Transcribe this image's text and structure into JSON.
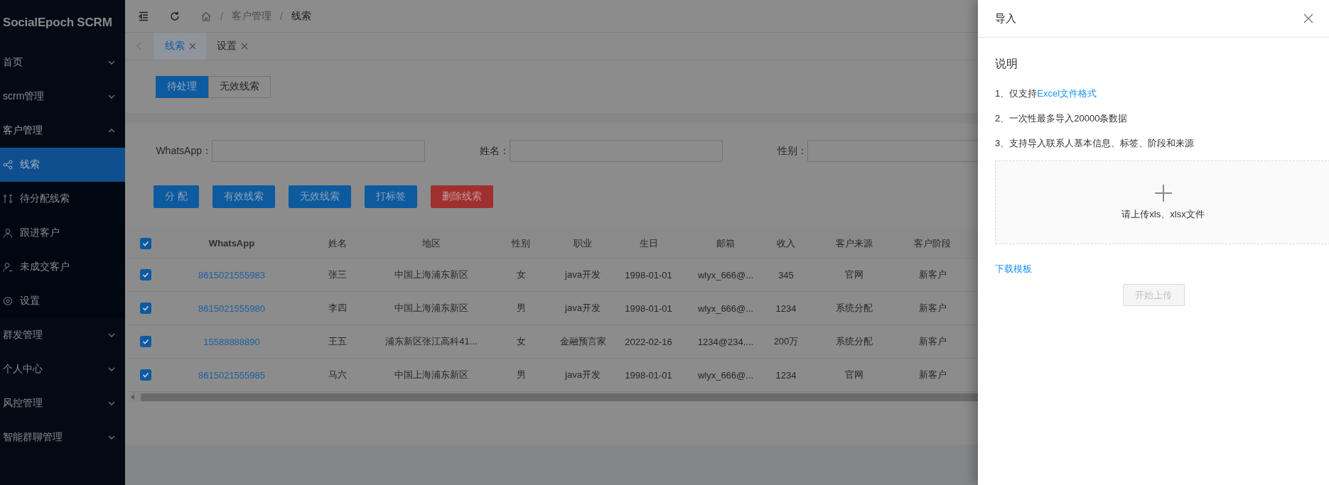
{
  "sidebar": {
    "logo": "SocialEpoch SCRM",
    "items": [
      {
        "label": "首页",
        "expanded": false
      },
      {
        "label": "scrm管理",
        "expanded": false
      },
      {
        "label": "客户管理",
        "expanded": true,
        "children": [
          {
            "label": "线索",
            "kind": "share",
            "selected": true
          },
          {
            "label": "待分配线索",
            "kind": "branch",
            "selected": false
          },
          {
            "label": "跟进客户",
            "kind": "user",
            "selected": false
          },
          {
            "label": "未成交客户",
            "kind": "user-minus",
            "selected": false
          },
          {
            "label": "设置",
            "kind": "gear",
            "selected": false
          }
        ]
      },
      {
        "label": "群发管理",
        "expanded": false
      },
      {
        "label": "个人中心",
        "expanded": false
      },
      {
        "label": "风控管理",
        "expanded": false
      },
      {
        "label": "智能群聊管理",
        "expanded": false
      }
    ]
  },
  "header": {
    "breadcrumb": [
      {
        "separator": "/",
        "label": "客户管理"
      },
      {
        "separator": "/",
        "label": "线索"
      }
    ]
  },
  "tabs": [
    {
      "label": "线索",
      "selected": true
    },
    {
      "label": "设置",
      "selected": false
    }
  ],
  "segments": [
    {
      "label": "待处理",
      "selected": true
    },
    {
      "label": "无效线索",
      "selected": false
    }
  ],
  "filters": [
    {
      "label": "WhatsApp："
    },
    {
      "label": "姓名："
    },
    {
      "label": "性别："
    }
  ],
  "actions": [
    {
      "label": "分 配",
      "kind": "primary"
    },
    {
      "label": "有效线索",
      "kind": "primary"
    },
    {
      "label": "无效线索",
      "kind": "primary"
    },
    {
      "label": "打标签",
      "kind": "primary"
    },
    {
      "label": "删除线索",
      "kind": "danger"
    }
  ],
  "table": {
    "all_checked": true,
    "columns": [
      "WhatsApp",
      "姓名",
      "地区",
      "性别",
      "职业",
      "生日",
      "邮箱",
      "收入",
      "客户来源",
      "客户阶段"
    ],
    "rows": [
      {
        "checked": true,
        "cells": [
          "8615021555983",
          "张三",
          "中国上海浦东新区",
          "女",
          "java开发",
          "1998-01-01",
          "wlyx_666@...",
          "345",
          "官网",
          "新客户"
        ]
      },
      {
        "checked": true,
        "cells": [
          "8615021555980",
          "李四",
          "中国上海浦东新区",
          "男",
          "java开发",
          "1998-01-01",
          "wlyx_666@...",
          "1234",
          "系统分配",
          "新客户"
        ]
      },
      {
        "checked": true,
        "cells": [
          "15588888890",
          "王五",
          "浦东新区张江高科41...",
          "女",
          "金融预言家",
          "2022-02-16",
          "1234@234....",
          "200万",
          "系统分配",
          "新客户"
        ]
      },
      {
        "checked": true,
        "cells": [
          "8615021555985",
          "马六",
          "中国上海浦东新区",
          "男",
          "java开发",
          "1998-01-01",
          "wlyx_666@...",
          "1234",
          "官网",
          "新客户"
        ]
      }
    ]
  },
  "drawer": {
    "title": "导入",
    "heading": "说明",
    "notes": [
      {
        "text": "1、仅支持",
        "link": "Excel文件格式"
      },
      {
        "text": "2、一次性最多导入20000条数据"
      },
      {
        "text": "3、支持导入联系人基本信息、标签、阶段和来源"
      }
    ],
    "upload_hint": "请上传xls、xlsx文件",
    "template_link": "下载模板",
    "submit": {
      "label": "开始上传",
      "disabled": true
    }
  }
}
